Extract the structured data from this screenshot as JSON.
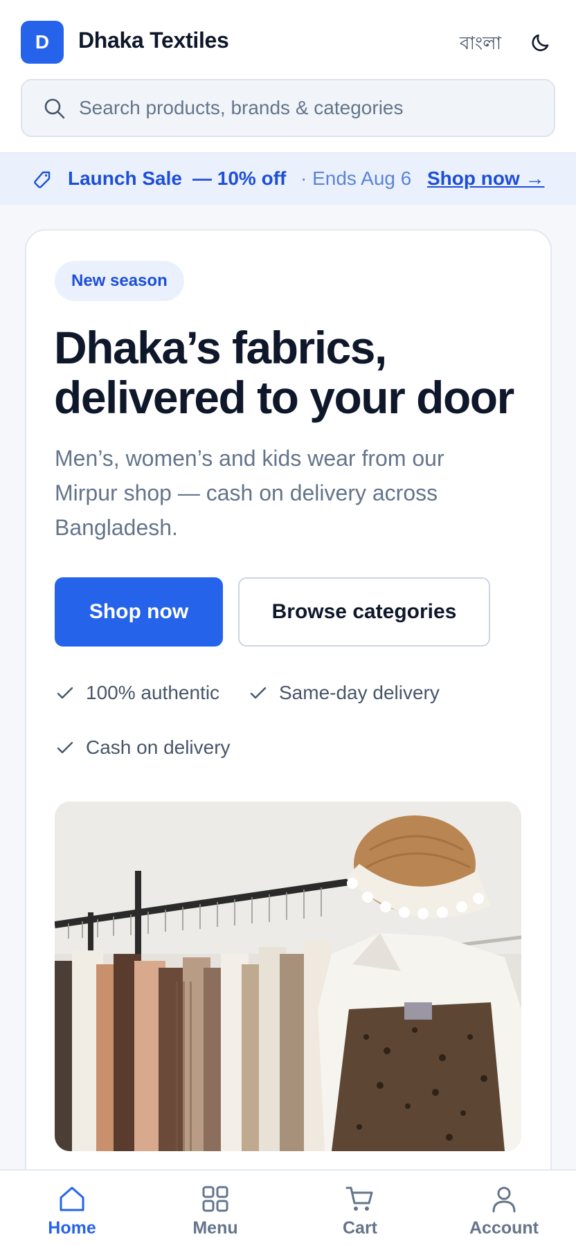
{
  "header": {
    "logo_letter": "D",
    "brand": "Dhaka Textiles",
    "language_toggle": "বাংলা",
    "theme_icon": "moon-icon"
  },
  "search": {
    "placeholder": "Search products, brands & categories",
    "icon": "search-icon"
  },
  "promo": {
    "icon": "tag-icon",
    "title": "Launch Sale",
    "discount": "— 10% off",
    "ends": "· Ends Aug 6",
    "link": "Shop now →"
  },
  "hero": {
    "badge": "New season",
    "title": "Dhaka’s fabrics, delivered to your door",
    "subtitle": "Men’s, women’s and kids wear from our Mirpur shop — cash on delivery across Bangladesh.",
    "primary_button": "Shop now",
    "secondary_button": "Browse categories",
    "features": [
      "100% authentic",
      "Same-day delivery",
      "Cash on delivery"
    ]
  },
  "bottom_nav": {
    "items": [
      {
        "label": "Home",
        "icon": "home-icon",
        "active": true
      },
      {
        "label": "Menu",
        "icon": "grid-icon",
        "active": false
      },
      {
        "label": "Cart",
        "icon": "cart-icon",
        "active": false
      },
      {
        "label": "Account",
        "icon": "user-icon",
        "active": false
      }
    ]
  },
  "colors": {
    "accent": "#2563eb",
    "promo_bg": "#eaf1fd",
    "text_dark": "#0f172a",
    "text_muted": "#64748b"
  }
}
